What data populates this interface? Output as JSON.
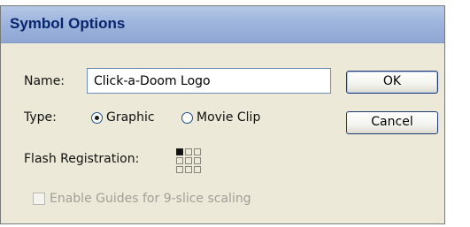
{
  "dialog": {
    "title": "Symbol Options",
    "name_label": "Name:",
    "name_value": "Click-a-Doom Logo",
    "ok_label": "OK",
    "cancel_label": "Cancel",
    "type_label": "Type:",
    "type_options": [
      {
        "label": "Graphic",
        "selected": true
      },
      {
        "label": "Movie Clip",
        "selected": false
      }
    ],
    "flash_registration_label": "Flash Registration:",
    "registration_icon": "registration-grid-icon",
    "guides_checkbox_label": "Enable Guides for 9-slice scaling",
    "guides_checkbox_checked": false,
    "guides_checkbox_enabled": false
  },
  "colors": {
    "title_text": "#08246b",
    "title_bar": "#9eb5dd",
    "dialog_bg": "#ece9d8",
    "button_border": "#1d3a72",
    "disabled_text": "#a19f96"
  }
}
